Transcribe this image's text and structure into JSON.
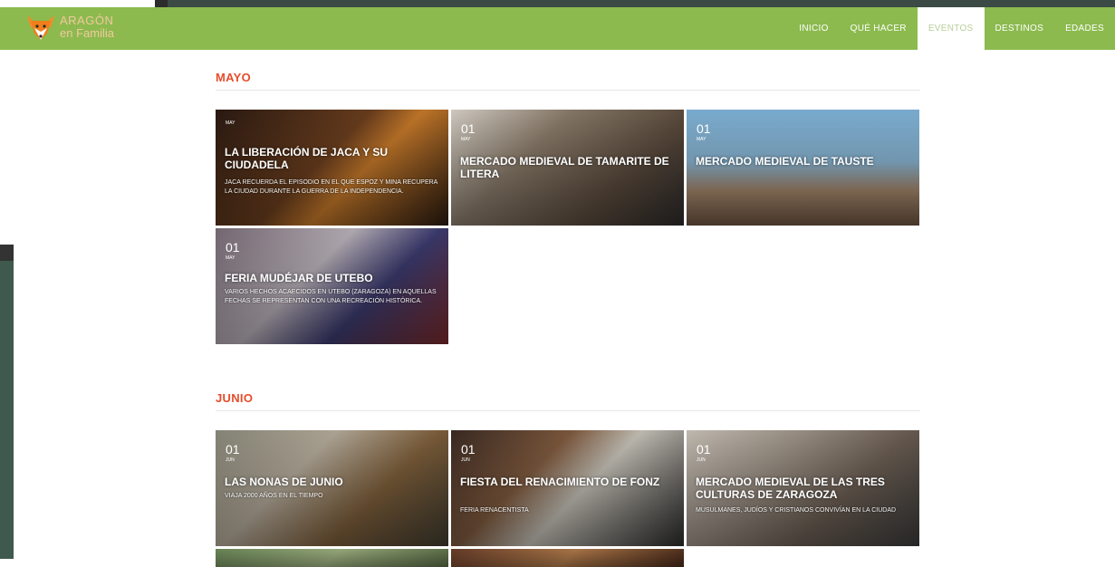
{
  "brand": {
    "line1": "Aragón",
    "line2": "en Familia"
  },
  "nav": {
    "items": [
      {
        "label": "Inicio",
        "active": false
      },
      {
        "label": "Qué hacer",
        "active": false
      },
      {
        "label": "Eventos",
        "active": true
      },
      {
        "label": "Destinos",
        "active": false
      },
      {
        "label": "Edades",
        "active": false
      }
    ]
  },
  "sections": [
    {
      "title": "MAYO",
      "cards": [
        {
          "day": "",
          "month": "MAY",
          "title": "LA LIBERACIÓN DE JACA Y SU CIUDADELA",
          "desc": "JACA RECUERDA EL EPISODIO EN EL QUE ESPOZ Y MINA RECUPERA LA CIUDAD DURANTE LA GUERRA DE LA INDEPENDENCIA."
        },
        {
          "day": "01",
          "month": "MAY",
          "title": "MERCADO MEDIEVAL DE TAMARITE DE LITERA",
          "desc": ""
        },
        {
          "day": "01",
          "month": "MAY",
          "title": "MERCADO MEDIEVAL DE TAUSTE",
          "desc": ""
        },
        {
          "day": "01",
          "month": "MAY",
          "title": "FERIA MUDÉJAR DE UTEBO",
          "desc": "VARIOS HECHOS ACAECIDOS EN UTEBO (ZARAGOZA) EN AQUELLAS FECHAS SE REPRESENTAN CON UNA RECREACIÓN HISTÓRICA."
        }
      ]
    },
    {
      "title": "JUNIO",
      "cards": [
        {
          "day": "01",
          "month": "JUN",
          "title": "LAS NONAS DE JUNIO",
          "desc": "VIAJA 2000 AÑOS EN EL TIEMPO"
        },
        {
          "day": "01",
          "month": "JUN",
          "title": "FIESTA DEL RENACIMIENTO DE FONZ",
          "desc": "FERIA RENACENTISTA"
        },
        {
          "day": "01",
          "month": "JUN",
          "title": "MERCADO MEDIEVAL DE LAS TRES CULTURAS DE ZARAGOZA",
          "desc": "MUSULMANES, JUDÍOS Y CRISTIANOS CONVIVÍAN EN LA CIUDAD"
        }
      ]
    }
  ],
  "colors": {
    "nav_green": "#8cba4e",
    "section_title": "#e74c2a"
  }
}
